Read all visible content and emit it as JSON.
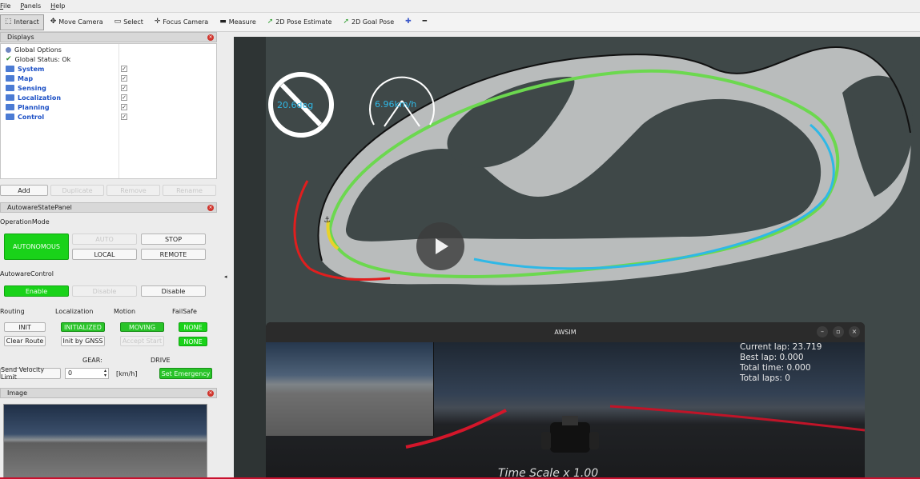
{
  "menu": {
    "file": "File",
    "panels": "Panels",
    "help": "Help"
  },
  "toolbar": {
    "interact": "Interact",
    "move_camera": "Move Camera",
    "select": "Select",
    "focus_camera": "Focus Camera",
    "measure": "Measure",
    "pose_estimate": "2D Pose Estimate",
    "goal_pose": "2D Goal Pose"
  },
  "displays": {
    "title": "Displays",
    "items": [
      {
        "label": "Global Options",
        "type": "option"
      },
      {
        "label": "Global Status: Ok",
        "type": "status"
      },
      {
        "label": "System",
        "type": "folder",
        "checked": true
      },
      {
        "label": "Map",
        "type": "folder",
        "checked": true
      },
      {
        "label": "Sensing",
        "type": "folder",
        "checked": true
      },
      {
        "label": "Localization",
        "type": "folder",
        "checked": true
      },
      {
        "label": "Planning",
        "type": "folder",
        "checked": true
      },
      {
        "label": "Control",
        "type": "folder",
        "checked": true
      }
    ],
    "buttons": {
      "add": "Add",
      "duplicate": "Duplicate",
      "remove": "Remove",
      "rename": "Rename"
    }
  },
  "state_panel": {
    "title": "AutowareStatePanel",
    "operation_mode": "OperationMode",
    "autonomous": "AUTONOMOUS",
    "auto": "AUTO",
    "stop": "STOP",
    "local": "LOCAL",
    "remote": "REMOTE",
    "autoware_control": "AutowareControl",
    "enable": "Enable",
    "disable_grey": "Disable",
    "disable": "Disable",
    "routing": "Routing",
    "localization": "Localization",
    "motion": "Motion",
    "failsafe": "FailSafe",
    "init": "INIT",
    "initialized": "INITIALIZED",
    "moving": "MOVING",
    "none1": "NONE",
    "none2": "NONE",
    "clear_route": "Clear Route",
    "init_gnss": "Init by GNSS",
    "accept_start": "Accept Start",
    "gear": "GEAR:",
    "drive": "DRIVE",
    "send_velocity": "Send Velocity Limit",
    "velocity_value": "0",
    "kmh": "[km/h]",
    "set_emergency": "Set Emergency"
  },
  "image_panel": {
    "title": "Image"
  },
  "viewport": {
    "steer": "20.6deg",
    "speed": "6.96km/h"
  },
  "awsim": {
    "title": "AWSIM",
    "current_lap": "Current lap: 23.719",
    "best_lap": "Best lap: 0.000",
    "total_time": "Total time: 0.000",
    "total_laps": "Total laps: 0",
    "time_scale": "Time Scale   x 1.00"
  },
  "colors": {
    "accent_green": "#19d219",
    "trajectory_cyan": "#2fb8e6",
    "close_red": "#d0342c"
  }
}
